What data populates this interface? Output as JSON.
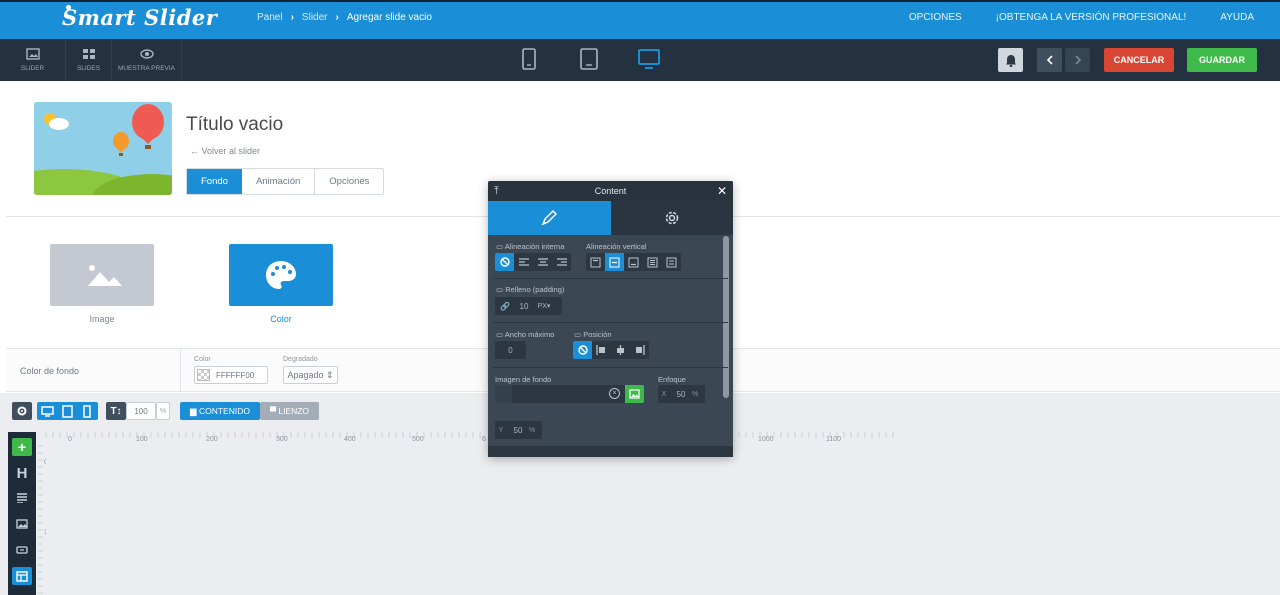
{
  "app": {
    "logo": "Smart Slider"
  },
  "breadcrumb": {
    "panel": "Panel",
    "slider": "Slider",
    "current": "Agregar slide vacio"
  },
  "top_links": [
    "OPCIONES",
    "¡OBTENGA LA VERSIÓN PROFESIONAL!",
    "AYUDA"
  ],
  "toolbar": {
    "slider": "SLIDER",
    "slides": "SLIDES",
    "preview": "MUESTRA PREVIA",
    "cancel": "CANCELAR",
    "save": "GUARDAR",
    "active_device": "desktop"
  },
  "slide": {
    "title": "Título vacio",
    "back_link": "Volver al slider",
    "tabs": [
      "Fondo",
      "Animación",
      "Opciones"
    ],
    "active_tab": "Fondo"
  },
  "background": {
    "options": [
      "Image",
      "Color"
    ],
    "selected": "Color",
    "row_label": "Color de fondo",
    "color_label": "Color",
    "color_value": "FFFFFF00",
    "gradient_label": "Degradado",
    "gradient_value": "Apagado"
  },
  "canvas": {
    "zoom_value": "100",
    "zoom_unit": "%",
    "mode_content": "CONTENIDO",
    "mode_canvas": "LIENZO",
    "ruler_ticks": [
      "0",
      "100",
      "200",
      "300",
      "400",
      "500",
      "6",
      "1000",
      "1100"
    ],
    "vruler_ticks": [
      "0",
      "100"
    ]
  },
  "panel": {
    "title": "Content",
    "inner_align_label": "Alineación interna",
    "vertical_align_label": "Alineación vertical",
    "padding_label": "Relleno (padding)",
    "padding_value": "10",
    "padding_unit": "PX",
    "max_width_label": "Ancho máximo",
    "max_width_value": "0",
    "position_label": "Posición",
    "bg_image_label": "Imagen de fondo",
    "focus_label": "Enfoque",
    "focus_x_label": "X",
    "focus_x": "50",
    "focus_y_label": "Y",
    "focus_y": "50",
    "percent": "%"
  },
  "colors": {
    "accent": "#1a8fd8",
    "save": "#3fb94a",
    "cancel": "#d94734",
    "toolbar": "#233140"
  }
}
